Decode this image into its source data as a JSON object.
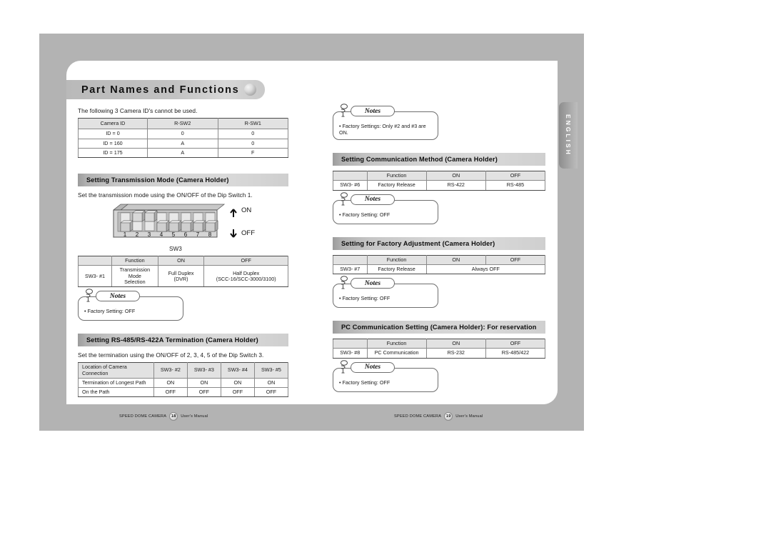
{
  "document": {
    "title": "Part Names and Functions",
    "language_tab": "ENGLISH"
  },
  "left_column": {
    "intro_text": "The following 3 Camera ID's cannot be used.",
    "id_table": {
      "headers": [
        "Camera ID",
        "R-SW2",
        "R-SW1"
      ],
      "rows": [
        [
          "ID = 0",
          "0",
          "0"
        ],
        [
          "ID = 160",
          "A",
          "0"
        ],
        [
          "ID = 175",
          "A",
          "F"
        ]
      ]
    },
    "transmission_section": {
      "heading": "Setting Transmission Mode (Camera Holder)",
      "description": "Set the transmission mode using the ON/OFF of the Dip Switch 1.",
      "switch_caption": "SW3",
      "switch_labels": [
        "1",
        "2",
        "3",
        "4",
        "5",
        "6",
        "7",
        "8"
      ],
      "switch_states": [
        "off",
        "on",
        "on",
        "off",
        "off",
        "off",
        "off",
        "off"
      ],
      "on_label": "ON",
      "off_label": "OFF",
      "table": {
        "headers": [
          "",
          "Function",
          "ON",
          "OFF"
        ],
        "rows": [
          [
            "SW3- #1",
            "Transmission Mode\nSelection",
            "Full Duplex\n(DVR)",
            "Half Duplex\n(SCC-16/SCC-3000/3100)"
          ]
        ]
      },
      "note": {
        "label": "Notes",
        "items": [
          "• Factory Setting: OFF"
        ]
      }
    },
    "termination_section": {
      "heading": "Setting RS-485/RS-422A Termination (Camera Holder)",
      "description": "Set the termination using the ON/OFF of 2, 3, 4, 5 of the Dip Switch 3.",
      "table": {
        "headers": [
          "Location of Camera Connection",
          "SW3- #2",
          "SW3- #3",
          "SW3- #4",
          "SW3- #5"
        ],
        "rows": [
          [
            "Termination of Longest Path",
            "ON",
            "ON",
            "ON",
            "ON"
          ],
          [
            "On the Path",
            "OFF",
            "OFF",
            "OFF",
            "OFF"
          ]
        ]
      }
    }
  },
  "right_column": {
    "top_note": {
      "label": "Notes",
      "items": [
        "• Factory Settings: Only #2 and #3 are ON."
      ]
    },
    "communication_section": {
      "heading": "Setting Communication Method (Camera Holder)",
      "table": {
        "headers": [
          "",
          "Function",
          "ON",
          "OFF"
        ],
        "rows": [
          [
            "SW3- #6",
            "Factory Release",
            "RS-422",
            "RS-485"
          ]
        ]
      },
      "note": {
        "label": "Notes",
        "items": [
          "• Factory Setting: OFF"
        ]
      }
    },
    "factory_adjustment_section": {
      "heading": "Setting for Factory Adjustment (Camera Holder)",
      "table": {
        "headers": [
          "",
          "Function",
          "ON",
          "OFF"
        ],
        "rows": [
          [
            "SW3- #7",
            "Factory Release",
            "Always OFF"
          ]
        ]
      },
      "note": {
        "label": "Notes",
        "items": [
          "• Factory Setting: OFF"
        ]
      }
    },
    "pc_communication_section": {
      "heading": "PC Communication Setting (Camera Holder): For reservation",
      "table": {
        "headers": [
          "",
          "Function",
          "ON",
          "OFF"
        ],
        "rows": [
          [
            "SW3- #8",
            "PC Communication",
            "RS-232",
            "RS-485/422"
          ]
        ]
      },
      "note": {
        "label": "Notes",
        "items": [
          "• Factory Setting: OFF"
        ]
      }
    }
  },
  "footer": {
    "left": {
      "product": "SPEED DOME CAMERA",
      "page": "18",
      "manual": "User's Manual"
    },
    "right": {
      "product": "SPEED DOME CAMERA",
      "page": "19",
      "manual": "User's Manual"
    }
  },
  "colors": {
    "frame_gray": "#b3b3b3",
    "header_bar": "#d4d4d4",
    "table_header": "#e2e2e2",
    "rule_dark": "#4a4a4a"
  }
}
